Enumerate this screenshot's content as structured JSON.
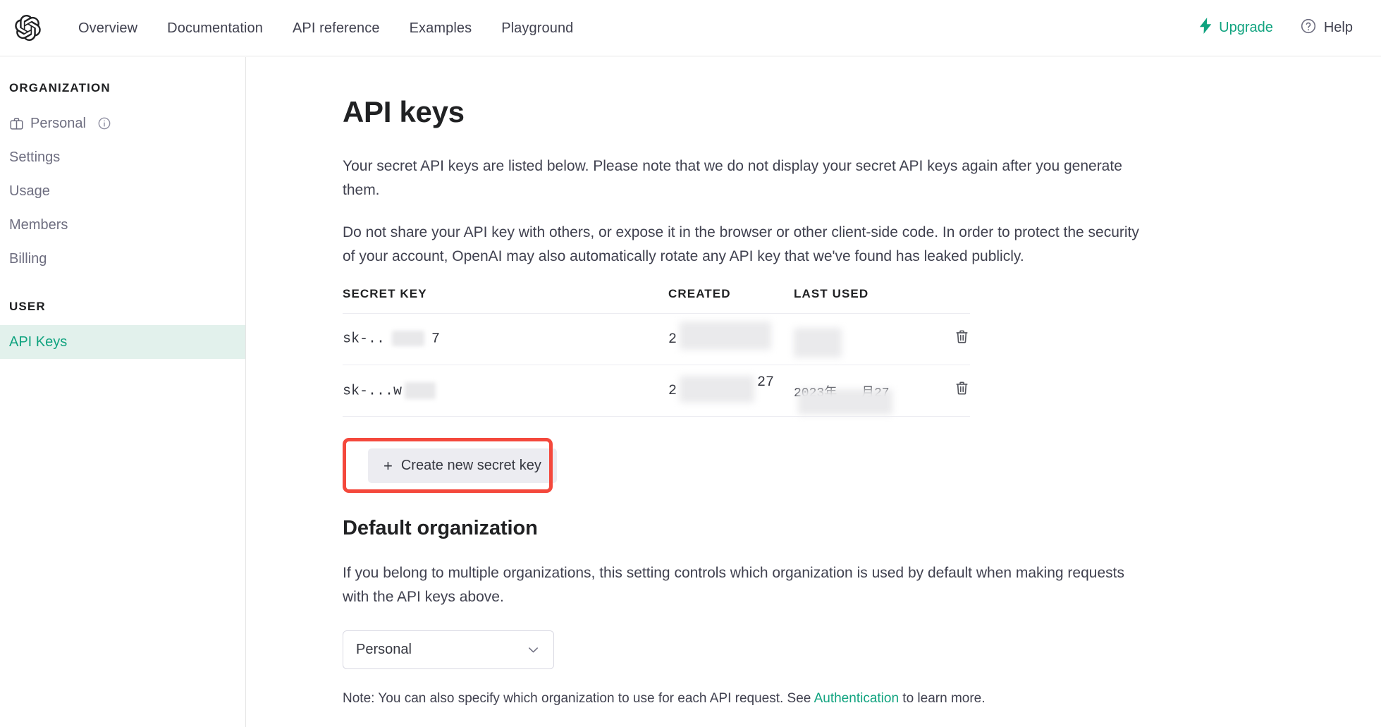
{
  "topnav": {
    "logo": "openai-logo",
    "links": [
      {
        "label": "Overview"
      },
      {
        "label": "Documentation"
      },
      {
        "label": "API reference"
      },
      {
        "label": "Examples"
      },
      {
        "label": "Playground"
      }
    ],
    "upgrade_label": "Upgrade",
    "help_label": "Help",
    "upgrade_color": "#10a37f"
  },
  "sidebar": {
    "org_section_title": "ORGANIZATION",
    "org_items": [
      {
        "label": "Personal",
        "icon": "briefcase-icon",
        "info": true
      },
      {
        "label": "Settings"
      },
      {
        "label": "Usage"
      },
      {
        "label": "Members"
      },
      {
        "label": "Billing"
      }
    ],
    "user_section_title": "USER",
    "user_items": [
      {
        "label": "API Keys",
        "active": true
      }
    ],
    "active_color": "#10a37f",
    "active_bg": "#e2f1ec"
  },
  "main": {
    "title": "API keys",
    "paragraph_1": "Your secret API keys are listed below. Please note that we do not display your secret API keys again after you generate them.",
    "paragraph_2": "Do not share your API key with others, or expose it in the browser or other client-side code. In order to protect the security of your account, OpenAI may also automatically rotate any API key that we've found has leaked publicly.",
    "table": {
      "headers": [
        "SECRET KEY",
        "CREATED",
        "LAST USED"
      ],
      "rows": [
        {
          "secret_key_prefix": "sk-..",
          "secret_key_suffix": "7",
          "created_visible": "2",
          "created_redacted": true,
          "last_used_visible": "",
          "last_used_redacted": true,
          "delete_icon": "trash-icon"
        },
        {
          "secret_key_prefix": "sk-...w",
          "secret_key_suffix": "",
          "created_visible": "2",
          "created_suffix": "27",
          "created_redacted": true,
          "last_used_visible": "2023年",
          "last_used_suffix": "月27",
          "last_used_redacted": true,
          "delete_icon": "trash-icon"
        }
      ]
    },
    "create_button_label": "Create new secret key",
    "create_button_plus": "+",
    "annotation_color": "#f4483c",
    "default_org": {
      "title": "Default organization",
      "description": "If you belong to multiple organizations, this setting controls which organization is used by default when making requests with the API keys above.",
      "select_value": "Personal",
      "select_caret": "chevron-down-icon",
      "note_prefix": "Note: You can also specify which organization to use for each API request. See ",
      "note_link": "Authentication",
      "note_suffix": " to learn more."
    }
  }
}
